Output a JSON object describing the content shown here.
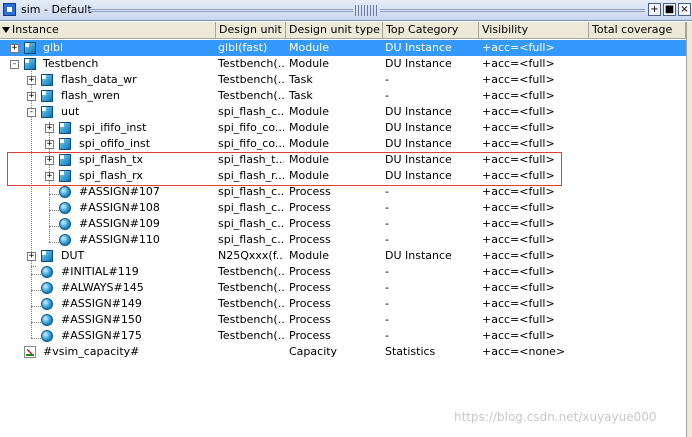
{
  "window": {
    "title": "sim - Default",
    "buttons": [
      "+",
      "■",
      "×"
    ]
  },
  "columns": [
    "Instance",
    "Design unit",
    "Design unit type",
    "Top Category",
    "Visibility",
    "Total coverage"
  ],
  "rows": [
    {
      "instance": "glbl",
      "design_unit": "glbl(fast)",
      "type": "Module",
      "category": "DU Instance",
      "visibility": "+acc=<full>",
      "expander": "+",
      "icon": "module-icon"
    },
    {
      "instance": "Testbench",
      "design_unit": "Testbench(...",
      "type": "Module",
      "category": "DU Instance",
      "visibility": "+acc=<full>",
      "expander": "-",
      "icon": "module-icon"
    },
    {
      "instance": "flash_data_wr",
      "design_unit": "Testbench(...",
      "type": "Task",
      "category": "-",
      "visibility": "+acc=<full>",
      "expander": "+",
      "icon": "module-icon"
    },
    {
      "instance": "flash_wren",
      "design_unit": "Testbench(...",
      "type": "Task",
      "category": "-",
      "visibility": "+acc=<full>",
      "expander": "+",
      "icon": "module-icon"
    },
    {
      "instance": "uut",
      "design_unit": "spi_flash_c...",
      "type": "Module",
      "category": "DU Instance",
      "visibility": "+acc=<full>",
      "expander": "-",
      "icon": "module-icon"
    },
    {
      "instance": "spi_ififo_inst",
      "design_unit": "spi_fifo_co...",
      "type": "Module",
      "category": "DU Instance",
      "visibility": "+acc=<full>",
      "expander": "+",
      "icon": "module-icon"
    },
    {
      "instance": "spi_ofifo_inst",
      "design_unit": "spi_fifo_co...",
      "type": "Module",
      "category": "DU Instance",
      "visibility": "+acc=<full>",
      "expander": "+",
      "icon": "module-icon"
    },
    {
      "instance": "spi_flash_tx",
      "design_unit": "spi_flash_t...",
      "type": "Module",
      "category": "DU Instance",
      "visibility": "+acc=<full>",
      "expander": "+",
      "icon": "module-icon"
    },
    {
      "instance": "spi_flash_rx",
      "design_unit": "spi_flash_r...",
      "type": "Module",
      "category": "DU Instance",
      "visibility": "+acc=<full>",
      "expander": "+",
      "icon": "module-icon"
    },
    {
      "instance": "#ASSIGN#107",
      "design_unit": "spi_flash_c...",
      "type": "Process",
      "category": "-",
      "visibility": "+acc=<full>",
      "expander": "",
      "icon": "process-icon"
    },
    {
      "instance": "#ASSIGN#108",
      "design_unit": "spi_flash_c...",
      "type": "Process",
      "category": "-",
      "visibility": "+acc=<full>",
      "expander": "",
      "icon": "process-icon"
    },
    {
      "instance": "#ASSIGN#109",
      "design_unit": "spi_flash_c...",
      "type": "Process",
      "category": "-",
      "visibility": "+acc=<full>",
      "expander": "",
      "icon": "process-icon"
    },
    {
      "instance": "#ASSIGN#110",
      "design_unit": "spi_flash_c...",
      "type": "Process",
      "category": "-",
      "visibility": "+acc=<full>",
      "expander": "",
      "icon": "process-icon"
    },
    {
      "instance": "DUT",
      "design_unit": "N25Qxxx(f...",
      "type": "Module",
      "category": "DU Instance",
      "visibility": "+acc=<full>",
      "expander": "+",
      "icon": "module-icon"
    },
    {
      "instance": "#INITIAL#119",
      "design_unit": "Testbench(...",
      "type": "Process",
      "category": "-",
      "visibility": "+acc=<full>",
      "expander": "",
      "icon": "process-icon"
    },
    {
      "instance": "#ALWAYS#145",
      "design_unit": "Testbench(...",
      "type": "Process",
      "category": "-",
      "visibility": "+acc=<full>",
      "expander": "",
      "icon": "process-icon"
    },
    {
      "instance": "#ASSIGN#149",
      "design_unit": "Testbench(...",
      "type": "Process",
      "category": "-",
      "visibility": "+acc=<full>",
      "expander": "",
      "icon": "process-icon"
    },
    {
      "instance": "#ASSIGN#150",
      "design_unit": "Testbench(...",
      "type": "Process",
      "category": "-",
      "visibility": "+acc=<full>",
      "expander": "",
      "icon": "process-icon"
    },
    {
      "instance": "#ASSIGN#175",
      "design_unit": "Testbench(...",
      "type": "Process",
      "category": "-",
      "visibility": "+acc=<full>",
      "expander": "",
      "icon": "process-icon"
    },
    {
      "instance": "#vsim_capacity#",
      "design_unit": "",
      "type": "Capacity",
      "category": "Statistics",
      "visibility": "+acc=<none>",
      "expander": "",
      "icon": "capacity-icon"
    }
  ],
  "selected_row": "glbl",
  "watermark": "https://blog.csdn.net/xuyayue000",
  "colors": {
    "selection": "#3399ff",
    "highlight_box": "#e0403a",
    "header_bg": "#ece9d8"
  }
}
